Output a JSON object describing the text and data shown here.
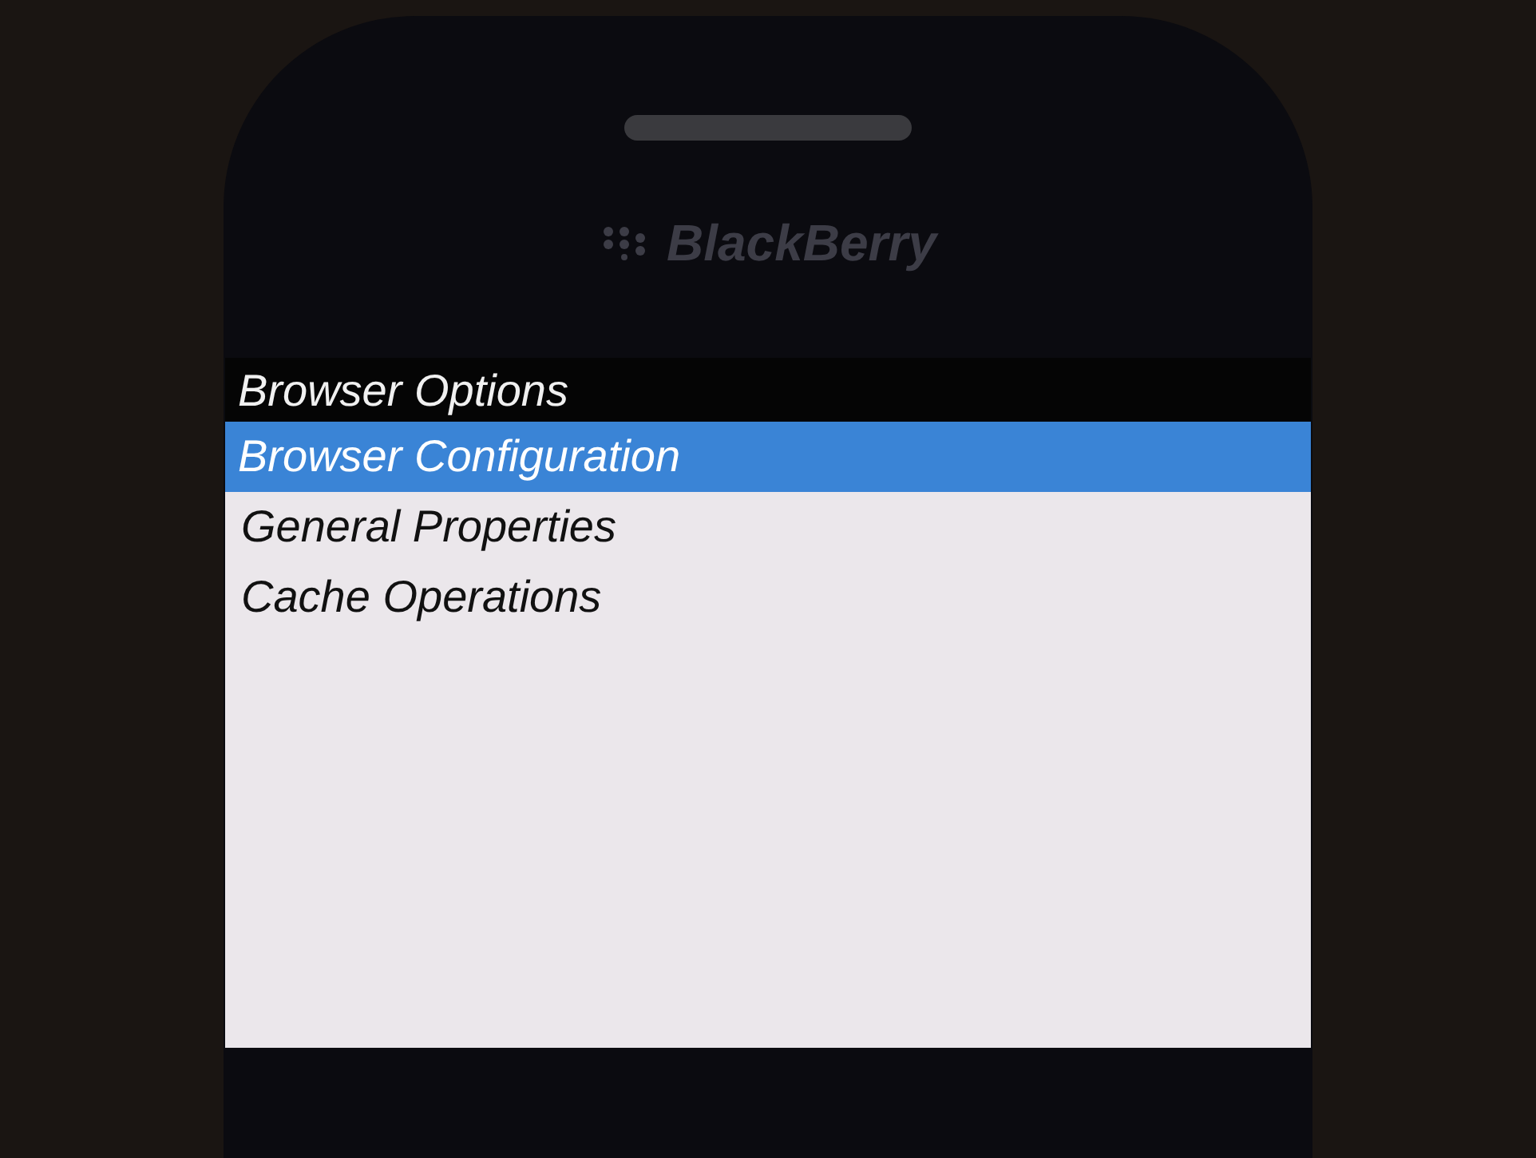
{
  "device": {
    "brand": "BlackBerry"
  },
  "screen": {
    "title": "Browser Options",
    "items": [
      {
        "label": "Browser Configuration",
        "selected": true
      },
      {
        "label": "General Properties",
        "selected": false
      },
      {
        "label": "Cache Operations",
        "selected": false
      }
    ]
  }
}
